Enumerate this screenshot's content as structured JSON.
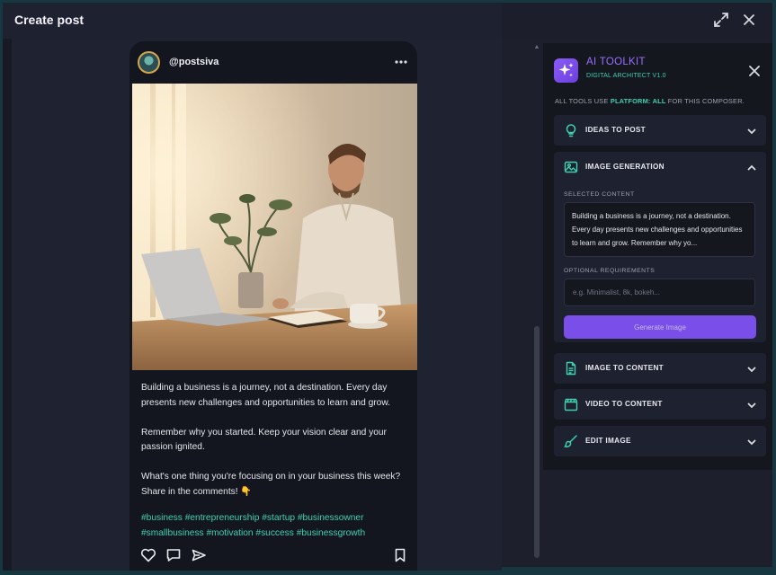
{
  "window": {
    "title": "Create post"
  },
  "post": {
    "handle": "@postsiva",
    "caption": [
      "Building a business is a journey, not a destination. Every day presents new challenges and opportunities to learn and grow.",
      "Remember why you started. Keep your vision clear and your passion ignited.",
      "What's one thing you're focusing on in your business this week? Share in the comments! 👇"
    ],
    "hashtags": "#business #entrepreneurship #startup #businessowner #smallbusiness #motivation #success #businessgrowth"
  },
  "toolkit": {
    "title": "AI TOOLKIT",
    "subtitle": "DIGITAL ARCHITECT V1.0",
    "note_prefix": "ALL TOOLS USE ",
    "note_platform": "PLATFORM: ALL",
    "note_suffix": " FOR THIS COMPOSER.",
    "sections": {
      "ideas": "IDEAS TO POST",
      "image_generation": "IMAGE GENERATION",
      "image_to_content": "IMAGE TO CONTENT",
      "video_to_content": "VIDEO TO CONTENT",
      "edit_image": "EDIT IMAGE"
    },
    "image_generation": {
      "selected_label": "SELECTED CONTENT",
      "selected_text": "Building a business is a journey, not a destination. Every day presents new challenges and opportunities to learn and grow. Remember why yo...",
      "optional_label": "OPTIONAL REQUIREMENTS",
      "optional_placeholder": "e.g. Minimalist, 8k, bokeh...",
      "optional_value": "",
      "generate_label": "Generate Image"
    }
  },
  "colors": {
    "accent_teal": "#3fd0b0",
    "accent_purple": "#7a4ee8",
    "brand_title": "#9a6dff"
  },
  "icons": {
    "expand": "expand-icon",
    "close": "close-icon",
    "more": "more-dots-icon",
    "heart": "heart-icon",
    "comment": "comment-icon",
    "share": "send-icon",
    "bookmark": "bookmark-icon"
  }
}
